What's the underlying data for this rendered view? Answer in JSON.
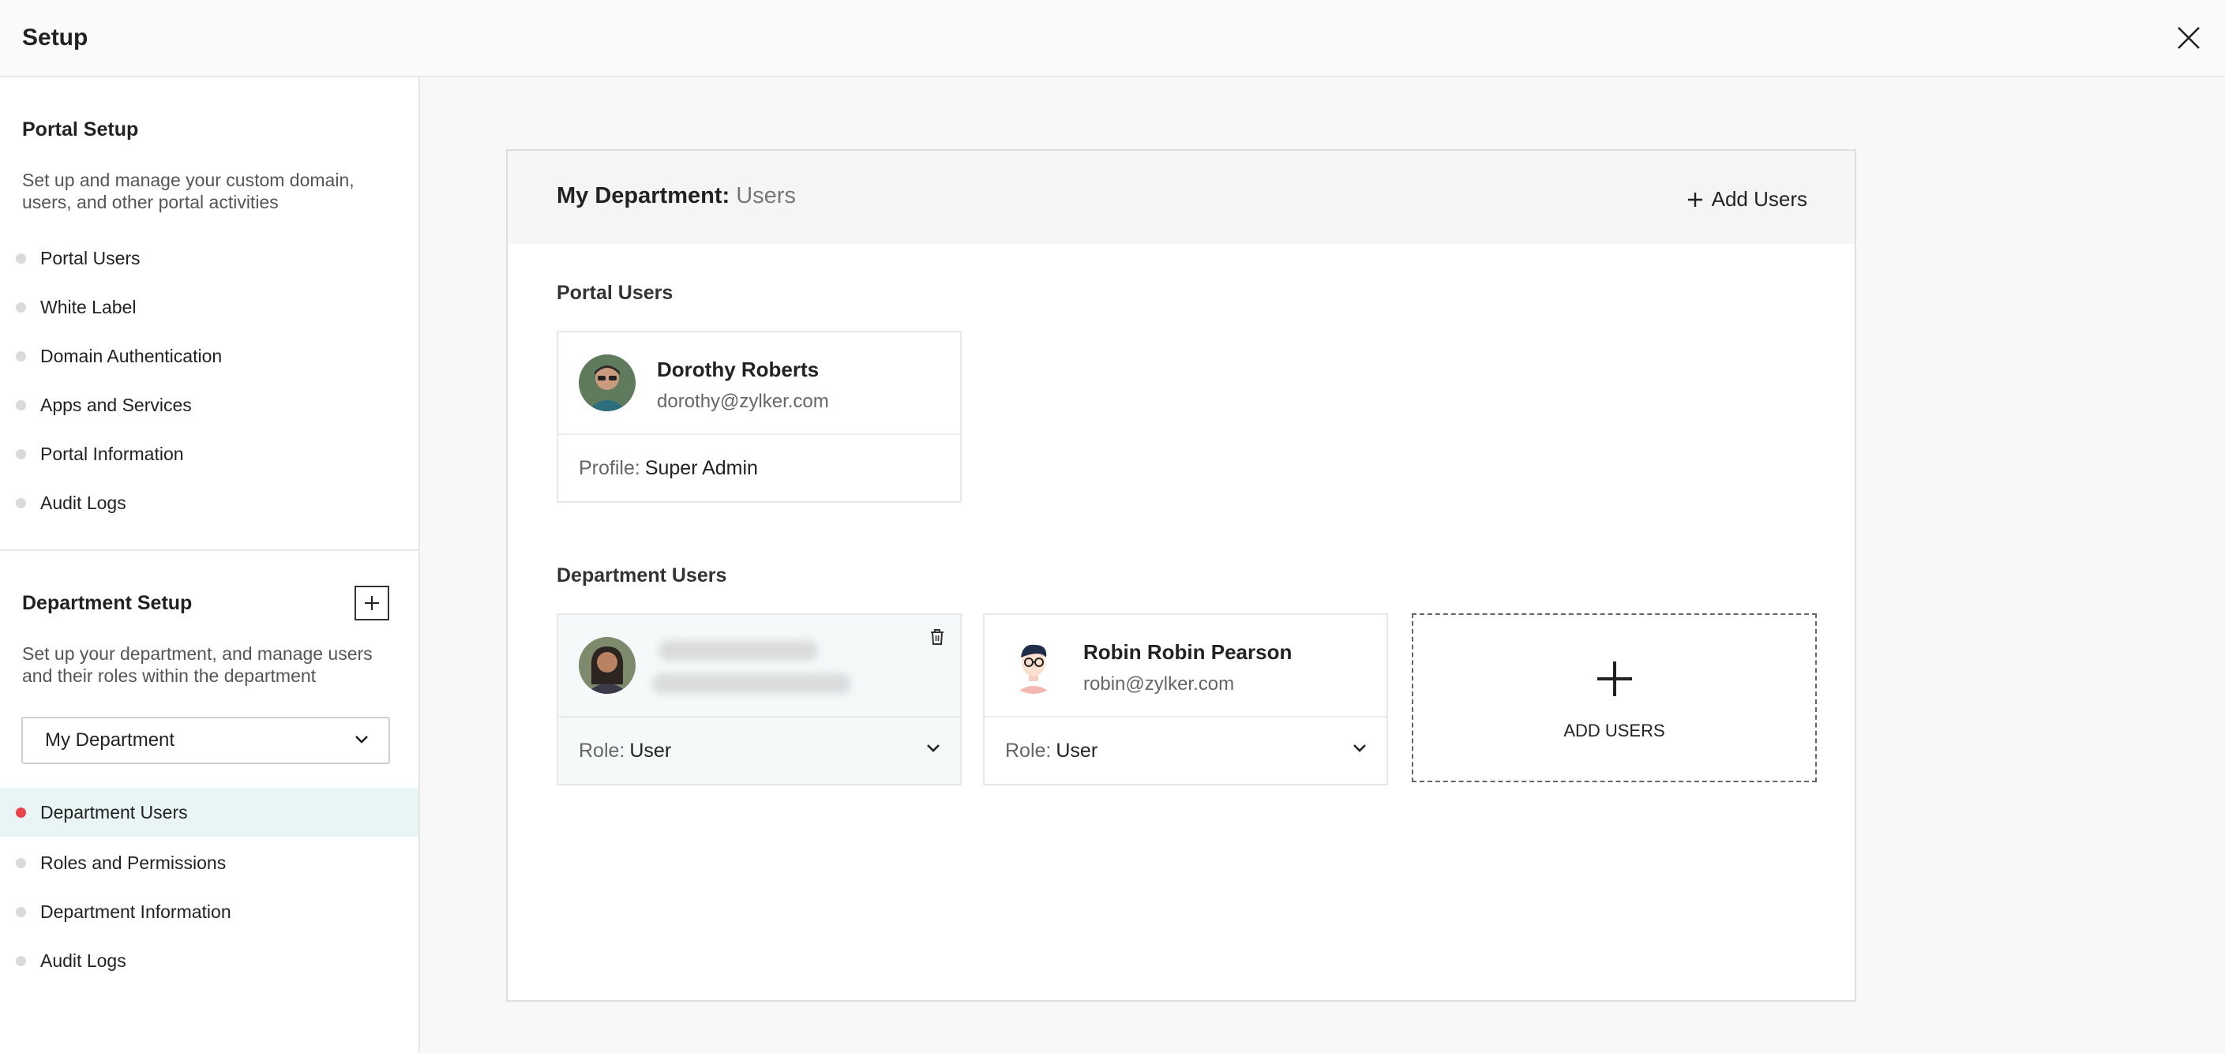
{
  "header": {
    "title": "Setup"
  },
  "sidebar": {
    "portal": {
      "title": "Portal Setup",
      "description": "Set up and manage your custom domain, users, and other portal activities",
      "items": [
        {
          "label": "Portal Users"
        },
        {
          "label": "White Label"
        },
        {
          "label": "Domain Authentication"
        },
        {
          "label": "Apps and Services"
        },
        {
          "label": "Portal Information"
        },
        {
          "label": "Audit Logs"
        }
      ]
    },
    "department": {
      "title": "Department Setup",
      "description": "Set up your department, and manage users and their roles within the department",
      "selected": "My Department",
      "items": [
        {
          "label": "Department Users",
          "active": true
        },
        {
          "label": "Roles and Permissions"
        },
        {
          "label": "Department Information"
        },
        {
          "label": "Audit Logs"
        }
      ]
    }
  },
  "panel": {
    "title_bold": "My Department:",
    "title_sub": "Users",
    "add_users_label": "Add Users",
    "portal_users_title": "Portal Users",
    "department_users_title": "Department Users",
    "portal_users": [
      {
        "name": "Dorothy Roberts",
        "email": "dorothy@zylker.com",
        "profile_key": "Profile:",
        "profile_value": "Super Admin"
      }
    ],
    "department_users": [
      {
        "role_key": "Role:",
        "role_value": "User"
      },
      {
        "name": "Robin Robin Pearson",
        "email": "robin@zylker.com",
        "role_key": "Role:",
        "role_value": "User"
      }
    ],
    "add_card_label": "ADD USERS"
  },
  "colors": {
    "active_dot": "#e8454f",
    "active_bg": "#e8f5f4"
  },
  "icons": {
    "close": "close-icon",
    "plus": "plus-icon",
    "chevron": "chevron-down-icon",
    "trash": "trash-icon"
  }
}
